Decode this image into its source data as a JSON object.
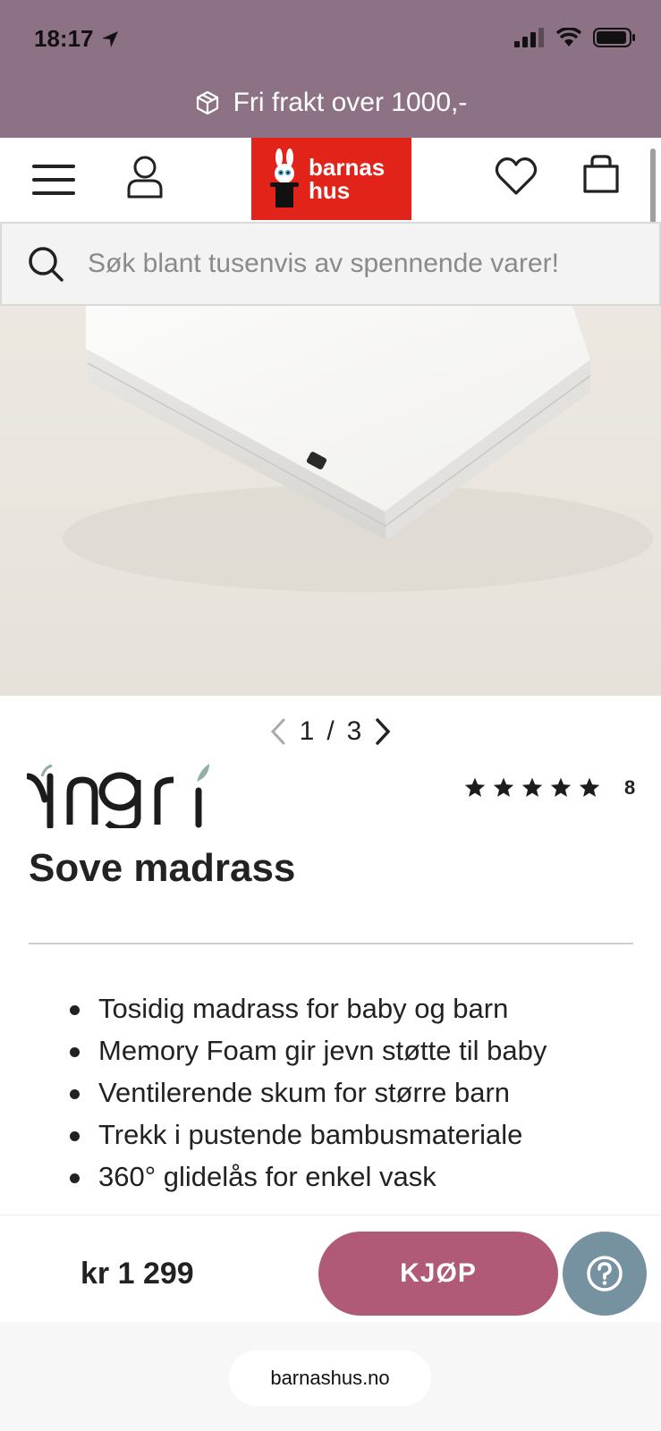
{
  "status": {
    "time": "18:17"
  },
  "promo": {
    "text": "Fri frakt over 1000,-",
    "icon": "package-icon"
  },
  "header": {
    "logo_text_line1": "barnas",
    "logo_text_line2": "hus",
    "logo_color": "#e2231a",
    "icons": [
      "menu-icon",
      "user-icon",
      "heart-icon",
      "bag-icon"
    ]
  },
  "search": {
    "placeholder": "Søk blant tusenvis av spennende varer!"
  },
  "gallery": {
    "current": "1",
    "separator": "/",
    "total": "3"
  },
  "product": {
    "brand": "Yngri",
    "title": "Sove madrass",
    "rating_stars": 5,
    "review_count": "8",
    "features": [
      "Tosidig madrass for baby og barn",
      "Memory Foam gir jevn støtte til baby",
      "Ventilerende skum for større barn",
      "Trekk i pustende bambusmateriale",
      "360° glidelås for enkel vask"
    ]
  },
  "buybar": {
    "price": "kr 1 299",
    "buy_label": "KJØP",
    "buy_color": "#b05a78",
    "help_color": "#7691a0"
  },
  "browser": {
    "url": "barnashus.no"
  },
  "theme": {
    "band_color": "#8d7285"
  }
}
